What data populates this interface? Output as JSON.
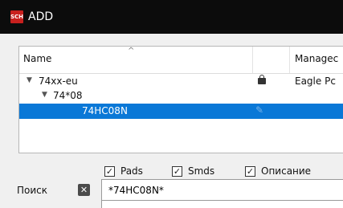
{
  "window": {
    "title": "ADD",
    "app_icon_text": "SCH"
  },
  "tree": {
    "columns": {
      "name": "Name",
      "managed": "Managec"
    },
    "rows": [
      {
        "label": "74xx-eu",
        "expander": "▼",
        "managed": "Eagle Pc",
        "status_icon": "lock-icon"
      },
      {
        "label": "74*08",
        "expander": "▼"
      },
      {
        "label": "74HC08N",
        "status_icon": "pin-icon",
        "selected": true
      }
    ]
  },
  "filters": {
    "pads": {
      "label": "Pads",
      "checked": true
    },
    "smds": {
      "label": "Smds",
      "checked": true
    },
    "description": {
      "label": "Описание",
      "checked": true
    }
  },
  "search": {
    "label": "Поиск",
    "value": "*74HC08N*"
  },
  "colors": {
    "titlebar": "#0c0c0c",
    "selection": "#0a78d7"
  }
}
